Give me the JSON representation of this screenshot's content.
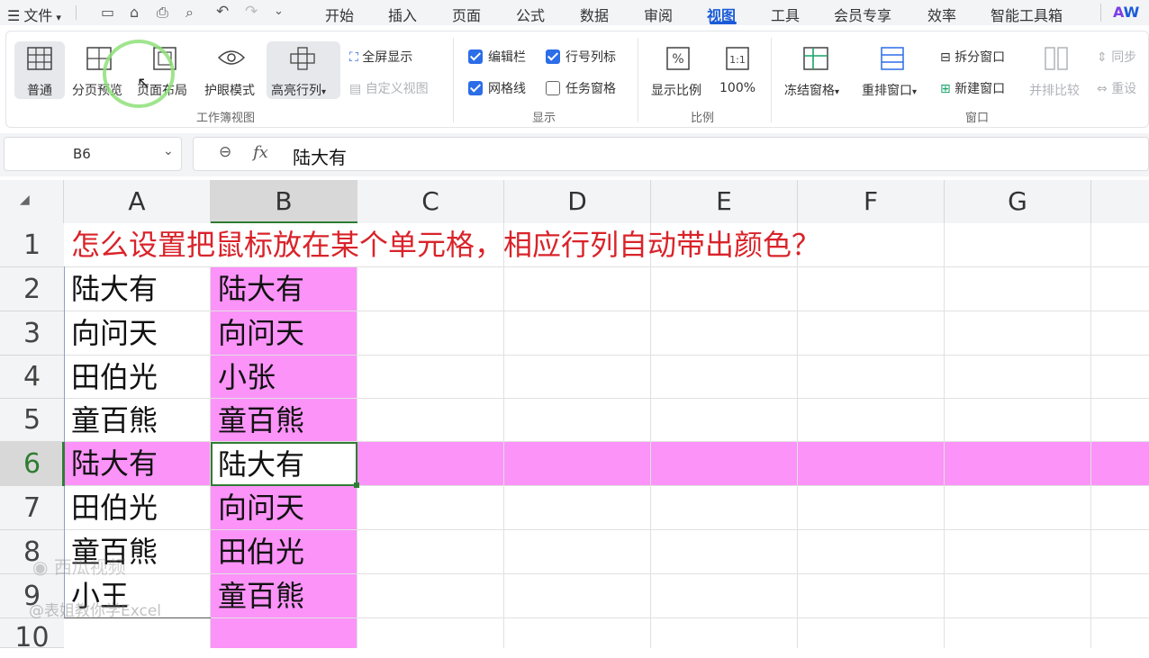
{
  "menu": {
    "file_label": "文件",
    "tabs": [
      "开始",
      "插入",
      "页面",
      "公式",
      "数据",
      "审阅",
      "视图",
      "工具",
      "会员专享",
      "效率",
      "智能工具箱"
    ],
    "active_tab": "视图",
    "extra": "W"
  },
  "ribbon": {
    "workbook_view": {
      "label": "工作簿视图",
      "normal": "普通",
      "page_break_preview": "分页预览",
      "page_layout": "页面布局",
      "eye_protection": "护眼模式",
      "highlight_row_col": "高亮行列",
      "full_screen": "全屏显示",
      "custom_view": "自定义视图"
    },
    "show": {
      "label": "显示",
      "formula_bar": "编辑栏",
      "headings": "行号列标",
      "gridlines": "网格线",
      "task_pane": "任务窗格"
    },
    "zoom": {
      "label": "比例",
      "zoom": "显示比例",
      "hundred_percent": "100%"
    },
    "window": {
      "label": "窗口",
      "freeze_panes": "冻结窗格",
      "arrange_all": "重排窗口",
      "split": "拆分窗口",
      "new_window": "新建窗口",
      "view_side_by_side": "并排比较",
      "sync_scroll": "同步",
      "reset_position": "重设"
    }
  },
  "formula_bar": {
    "name_box": "B6",
    "fx": "fx",
    "content": "陆大有"
  },
  "sheet": {
    "columns": [
      "A",
      "B",
      "C",
      "D",
      "E",
      "F",
      "G"
    ],
    "rows": [
      "1",
      "2",
      "3",
      "4",
      "5",
      "6",
      "7",
      "8",
      "9",
      "10"
    ],
    "selected_cell": "B6",
    "highlight_color": "#fb93f8",
    "title": "怎么设置把鼠标放在某个单元格，相应行列自动带出颜色？",
    "title_color": "#d9232a",
    "col_a": [
      "陆大有",
      "向问天",
      "田伯光",
      "童百熊",
      "陆大有",
      "田伯光",
      "童百熊",
      "小王"
    ],
    "col_b": [
      "陆大有",
      "向问天",
      "小张",
      "童百熊",
      "陆大有",
      "向问天",
      "田伯光",
      "童百熊"
    ]
  },
  "watermark": {
    "line1": "西瓜视频",
    "line2": "@表姐教你学Excel"
  }
}
